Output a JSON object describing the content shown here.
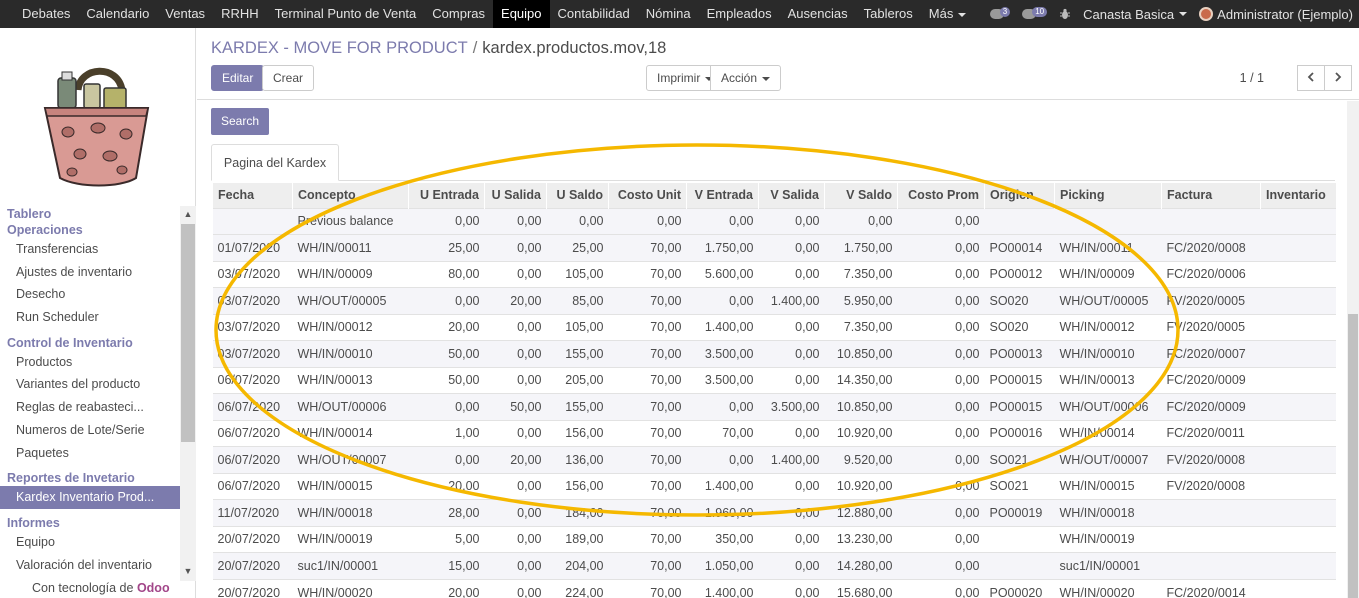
{
  "topbar": {
    "menu": [
      "Debates",
      "Calendario",
      "Ventas",
      "RRHH",
      "Terminal Punto de Venta",
      "Compras",
      "Equipo",
      "Contabilidad",
      "Nómina",
      "Empleados",
      "Ausencias",
      "Tableros",
      "Más"
    ],
    "active": "Equipo",
    "chat_count": "3",
    "activity_count": "10",
    "company": "Canasta Basica",
    "user": "Administrator (Ejemplo)"
  },
  "sidebar": {
    "sections": [
      {
        "title": "Tablero",
        "items": []
      },
      {
        "title": "Operaciones",
        "items": [
          "Transferencias",
          "Ajustes de inventario",
          "Desecho",
          "Run Scheduler"
        ]
      },
      {
        "title": "Control de Inventario",
        "items": [
          "Productos",
          "Variantes del producto",
          "Reglas de reabasteci...",
          "Numeros de Lote/Serie",
          "Paquetes"
        ]
      },
      {
        "title": "Reportes de Invetario",
        "items": [
          "Kardex Inventario Prod..."
        ]
      },
      {
        "title": "Informes",
        "items": [
          "Equipo",
          "Valoración del inventario"
        ]
      }
    ],
    "active_item": "Kardex Inventario Prod...",
    "powered_prefix": "Con tecnología de",
    "powered_brand": "Odoo"
  },
  "control": {
    "breadcrumb_parent": "KARDEX - MOVE FOR PRODUCT",
    "breadcrumb_separator": "/",
    "breadcrumb_current": "kardex.productos.mov,18",
    "edit_label": "Editar",
    "create_label": "Crear",
    "print_label": "Imprimir",
    "action_label": "Acción",
    "pager": "1 / 1"
  },
  "content": {
    "search_label": "Search",
    "tab_label": "Pagina del Kardex"
  },
  "table": {
    "columns": [
      "Fecha",
      "Concepto",
      "U Entrada",
      "U Salida",
      "U Saldo",
      "Costo Unit",
      "V Entrada",
      "V Salida",
      "V Saldo",
      "Costo Prom",
      "Origien",
      "Picking",
      "Factura",
      "Inventario"
    ],
    "rows": [
      [
        "",
        "Previous balance",
        "0,00",
        "0,00",
        "0,00",
        "0,00",
        "0,00",
        "0,00",
        "0,00",
        "0,00",
        "",
        "",
        "",
        ""
      ],
      [
        "01/07/2020",
        "WH/IN/00011",
        "25,00",
        "0,00",
        "25,00",
        "70,00",
        "1.750,00",
        "0,00",
        "1.750,00",
        "0,00",
        "PO00014",
        "WH/IN/00011",
        "FC/2020/0008",
        ""
      ],
      [
        "03/07/2020",
        "WH/IN/00009",
        "80,00",
        "0,00",
        "105,00",
        "70,00",
        "5.600,00",
        "0,00",
        "7.350,00",
        "0,00",
        "PO00012",
        "WH/IN/00009",
        "FC/2020/0006",
        ""
      ],
      [
        "03/07/2020",
        "WH/OUT/00005",
        "0,00",
        "20,00",
        "85,00",
        "70,00",
        "0,00",
        "1.400,00",
        "5.950,00",
        "0,00",
        "SO020",
        "WH/OUT/00005",
        "FV/2020/0005",
        ""
      ],
      [
        "03/07/2020",
        "WH/IN/00012",
        "20,00",
        "0,00",
        "105,00",
        "70,00",
        "1.400,00",
        "0,00",
        "7.350,00",
        "0,00",
        "SO020",
        "WH/IN/00012",
        "FV/2020/0005",
        ""
      ],
      [
        "03/07/2020",
        "WH/IN/00010",
        "50,00",
        "0,00",
        "155,00",
        "70,00",
        "3.500,00",
        "0,00",
        "10.850,00",
        "0,00",
        "PO00013",
        "WH/IN/00010",
        "FC/2020/0007",
        ""
      ],
      [
        "06/07/2020",
        "WH/IN/00013",
        "50,00",
        "0,00",
        "205,00",
        "70,00",
        "3.500,00",
        "0,00",
        "14.350,00",
        "0,00",
        "PO00015",
        "WH/IN/00013",
        "FC/2020/0009",
        ""
      ],
      [
        "06/07/2020",
        "WH/OUT/00006",
        "0,00",
        "50,00",
        "155,00",
        "70,00",
        "0,00",
        "3.500,00",
        "10.850,00",
        "0,00",
        "PO00015",
        "WH/OUT/00006",
        "FC/2020/0009",
        ""
      ],
      [
        "06/07/2020",
        "WH/IN/00014",
        "1,00",
        "0,00",
        "156,00",
        "70,00",
        "70,00",
        "0,00",
        "10.920,00",
        "0,00",
        "PO00016",
        "WH/IN/00014",
        "FC/2020/0011",
        ""
      ],
      [
        "06/07/2020",
        "WH/OUT/00007",
        "0,00",
        "20,00",
        "136,00",
        "70,00",
        "0,00",
        "1.400,00",
        "9.520,00",
        "0,00",
        "SO021",
        "WH/OUT/00007",
        "FV/2020/0008",
        ""
      ],
      [
        "06/07/2020",
        "WH/IN/00015",
        "20,00",
        "0,00",
        "156,00",
        "70,00",
        "1.400,00",
        "0,00",
        "10.920,00",
        "0,00",
        "SO021",
        "WH/IN/00015",
        "FV/2020/0008",
        ""
      ],
      [
        "11/07/2020",
        "WH/IN/00018",
        "28,00",
        "0,00",
        "184,00",
        "70,00",
        "1.960,00",
        "0,00",
        "12.880,00",
        "0,00",
        "PO00019",
        "WH/IN/00018",
        "",
        ""
      ],
      [
        "20/07/2020",
        "WH/IN/00019",
        "5,00",
        "0,00",
        "189,00",
        "70,00",
        "350,00",
        "0,00",
        "13.230,00",
        "0,00",
        "",
        "WH/IN/00019",
        "",
        ""
      ],
      [
        "20/07/2020",
        "suc1/IN/00001",
        "15,00",
        "0,00",
        "204,00",
        "70,00",
        "1.050,00",
        "0,00",
        "14.280,00",
        "0,00",
        "",
        "suc1/IN/00001",
        "",
        ""
      ],
      [
        "20/07/2020",
        "WH/IN/00020",
        "20,00",
        "0,00",
        "224,00",
        "70,00",
        "1.400,00",
        "0,00",
        "15.680,00",
        "0,00",
        "PO00020",
        "WH/IN/00020",
        "FC/2020/0014",
        ""
      ]
    ]
  },
  "colors": {
    "brand": "#7c7bad",
    "topbar": "#2a2a2a",
    "highlight_ellipse": "#f5b800"
  }
}
